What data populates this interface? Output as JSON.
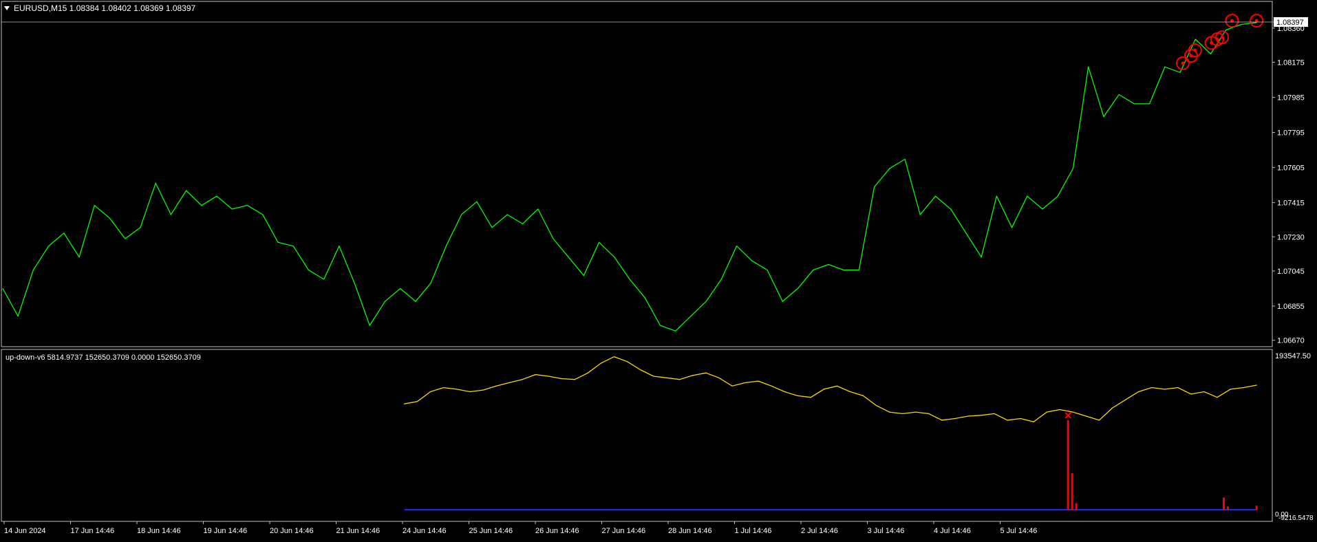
{
  "colors": {
    "background": "#000000",
    "price_line": "#00ff00",
    "indicator_line": "#ffd700",
    "histogram": "#ff0000",
    "baseline": "#1a2cff",
    "markers": "#ff0000",
    "frame": "#c0c0c0",
    "text": "#ffffff"
  },
  "main_panel": {
    "header_icon": "triangle-down-icon",
    "header": "EURUSD,M15  1.08384 1.08402 1.08369 1.08397",
    "current_price_label": "1.08397"
  },
  "indicator_panel": {
    "header": "up-down-v6 5814.9737 152650.3709 0.0000 152650.3709",
    "top_label": "193547.50",
    "bottom_label_a": "0.00",
    "bottom_label_b": "-9216.5478"
  },
  "x_axis_labels": [
    "14 Jun 2024",
    "17 Jun 14:46",
    "18 Jun 14:46",
    "19 Jun 14:46",
    "20 Jun 14:46",
    "21 Jun 14:46",
    "24 Jun 14:46",
    "25 Jun 14:46",
    "26 Jun 14:46",
    "27 Jun 14:46",
    "28 Jun 14:46",
    "1 Jul 14:46",
    "2 Jul 14:46",
    "3 Jul 14:46",
    "4 Jul 14:46",
    "5 Jul 14:46"
  ],
  "chart_data": [
    {
      "type": "line",
      "title": "EURUSD,M15",
      "ohlc_last": {
        "open": 1.08384,
        "high": 1.08402,
        "low": 1.08369,
        "close": 1.08397
      },
      "y_ticks": [
        1.0836,
        1.08175,
        1.07985,
        1.07795,
        1.07605,
        1.07415,
        1.0723,
        1.07045,
        1.06855,
        1.0667
      ],
      "ylim": [
        1.0665,
        1.0846
      ],
      "x_labels": [
        "14 Jun 2024",
        "17 Jun 14:46",
        "18 Jun 14:46",
        "19 Jun 14:46",
        "20 Jun 14:46",
        "21 Jun 14:46",
        "24 Jun 14:46",
        "25 Jun 14:46",
        "26 Jun 14:46",
        "27 Jun 14:46",
        "28 Jun 14:46",
        "1 Jul 14:46",
        "2 Jul 14:46",
        "3 Jul 14:46",
        "4 Jul 14:46",
        "5 Jul 14:46"
      ],
      "x": [
        0,
        0.3,
        0.5,
        0.8,
        1.0,
        1.2,
        1.4,
        1.6,
        1.8,
        2.0,
        2.2,
        2.4,
        2.6,
        2.8,
        3.0,
        3.2,
        3.4,
        3.6,
        3.8,
        4.0,
        4.2,
        4.4,
        4.6,
        4.8,
        5.0,
        5.2,
        5.4,
        5.6,
        5.8,
        6.0,
        6.2,
        6.4,
        6.6,
        6.8,
        7.0,
        7.2,
        7.4,
        7.6,
        7.8,
        8.0,
        8.2,
        8.4,
        8.6,
        8.8,
        9.0,
        9.2,
        9.4,
        9.6,
        9.8,
        10.0,
        10.2,
        10.4,
        10.6,
        10.8,
        11.0,
        11.2,
        11.4,
        11.6,
        11.8,
        12.0,
        12.2,
        12.4,
        12.6,
        12.8,
        13.0,
        13.2,
        13.4,
        13.6,
        13.8,
        14.0,
        14.2,
        14.4,
        14.6,
        14.8,
        15.0,
        15.3
      ],
      "series": [
        {
          "values": [
            1.0695,
            1.068,
            1.0705,
            1.0718,
            1.0725,
            1.0712,
            1.074,
            1.0733,
            1.0722,
            1.0728,
            1.0752,
            1.0735,
            1.0748,
            1.074,
            1.0745,
            1.0738,
            1.074,
            1.0735,
            1.072,
            1.0718,
            1.0705,
            1.07,
            1.0718,
            1.0698,
            1.0675,
            1.0688,
            1.0695,
            1.0688,
            1.0698,
            1.0718,
            1.0735,
            1.0742,
            1.0728,
            1.0735,
            1.073,
            1.0738,
            1.0722,
            1.0712,
            1.0702,
            1.072,
            1.0712,
            1.07,
            1.069,
            1.0675,
            1.0672,
            1.068,
            1.0688,
            1.07,
            1.0718,
            1.071,
            1.0705,
            1.0688,
            1.0695,
            1.0705,
            1.0708,
            1.0705,
            1.0705,
            1.075,
            1.076,
            1.0765,
            1.0735,
            1.0745,
            1.0738,
            1.0725,
            1.0712,
            1.0745,
            1.0728,
            1.0745,
            1.0738,
            1.0745,
            1.076,
            1.0815,
            1.0788,
            1.08,
            1.0795,
            1.0795,
            1.0815,
            1.0812,
            1.083,
            1.0822,
            1.0835,
            1.0838,
            1.0839
          ]
        }
      ],
      "markers": [
        {
          "x": 14.4,
          "y": 1.0817
        },
        {
          "x": 14.5,
          "y": 1.0821
        },
        {
          "x": 14.55,
          "y": 1.0824
        },
        {
          "x": 14.75,
          "y": 1.0828
        },
        {
          "x": 14.82,
          "y": 1.083
        },
        {
          "x": 14.88,
          "y": 1.0831
        },
        {
          "x": 15.0,
          "y": 1.084
        },
        {
          "x": 15.3,
          "y": 1.084
        }
      ]
    },
    {
      "type": "line",
      "title": "up-down-v6",
      "values_header": [
        5814.9737,
        152650.3709,
        0.0,
        152650.3709
      ],
      "ylim": [
        -9216.5478,
        193547.5
      ],
      "x": [
        4.9,
        5.1,
        5.3,
        5.5,
        5.7,
        5.9,
        6.1,
        6.3,
        6.5,
        6.7,
        6.9,
        7.1,
        7.3,
        7.5,
        7.7,
        7.9,
        8.1,
        8.3,
        8.5,
        8.7,
        8.9,
        9.1,
        9.3,
        9.5,
        9.7,
        9.9,
        10.1,
        10.3,
        10.5,
        10.7,
        10.9,
        11.1,
        11.3,
        11.5,
        11.7,
        11.9,
        12.1,
        12.3,
        12.5,
        12.7,
        12.9,
        13.1,
        13.3,
        13.5,
        13.7,
        13.9,
        14.1,
        14.3,
        14.5,
        14.7,
        14.9,
        15.1,
        15.3
      ],
      "series": [
        {
          "values": [
            130000,
            133000,
            145000,
            150000,
            148000,
            145000,
            147000,
            152000,
            156000,
            160000,
            166000,
            164000,
            161000,
            160000,
            168000,
            180000,
            188000,
            182000,
            172000,
            164000,
            162000,
            160000,
            165000,
            168000,
            162000,
            152000,
            156000,
            158000,
            152000,
            145000,
            140000,
            138000,
            148000,
            152000,
            145000,
            140000,
            128000,
            120000,
            118000,
            120000,
            118000,
            110000,
            112000,
            115000,
            116000,
            118000,
            110000,
            112000,
            108000,
            120000,
            123000,
            120000,
            115000,
            110000,
            125000,
            135000,
            145000,
            150000,
            148000,
            150000,
            142000,
            145000,
            138000,
            148000,
            150000,
            153000
          ]
        }
      ],
      "histogram": [
        {
          "x": 13.0,
          "value": 110000
        },
        {
          "x": 13.05,
          "value": 45000
        },
        {
          "x": 13.1,
          "value": 8000
        },
        {
          "x": 14.9,
          "value": 15000
        },
        {
          "x": 14.95,
          "value": 4000
        },
        {
          "x": 15.3,
          "value": 5000
        }
      ],
      "marker": {
        "x": 13.0,
        "value": 116000
      }
    }
  ]
}
